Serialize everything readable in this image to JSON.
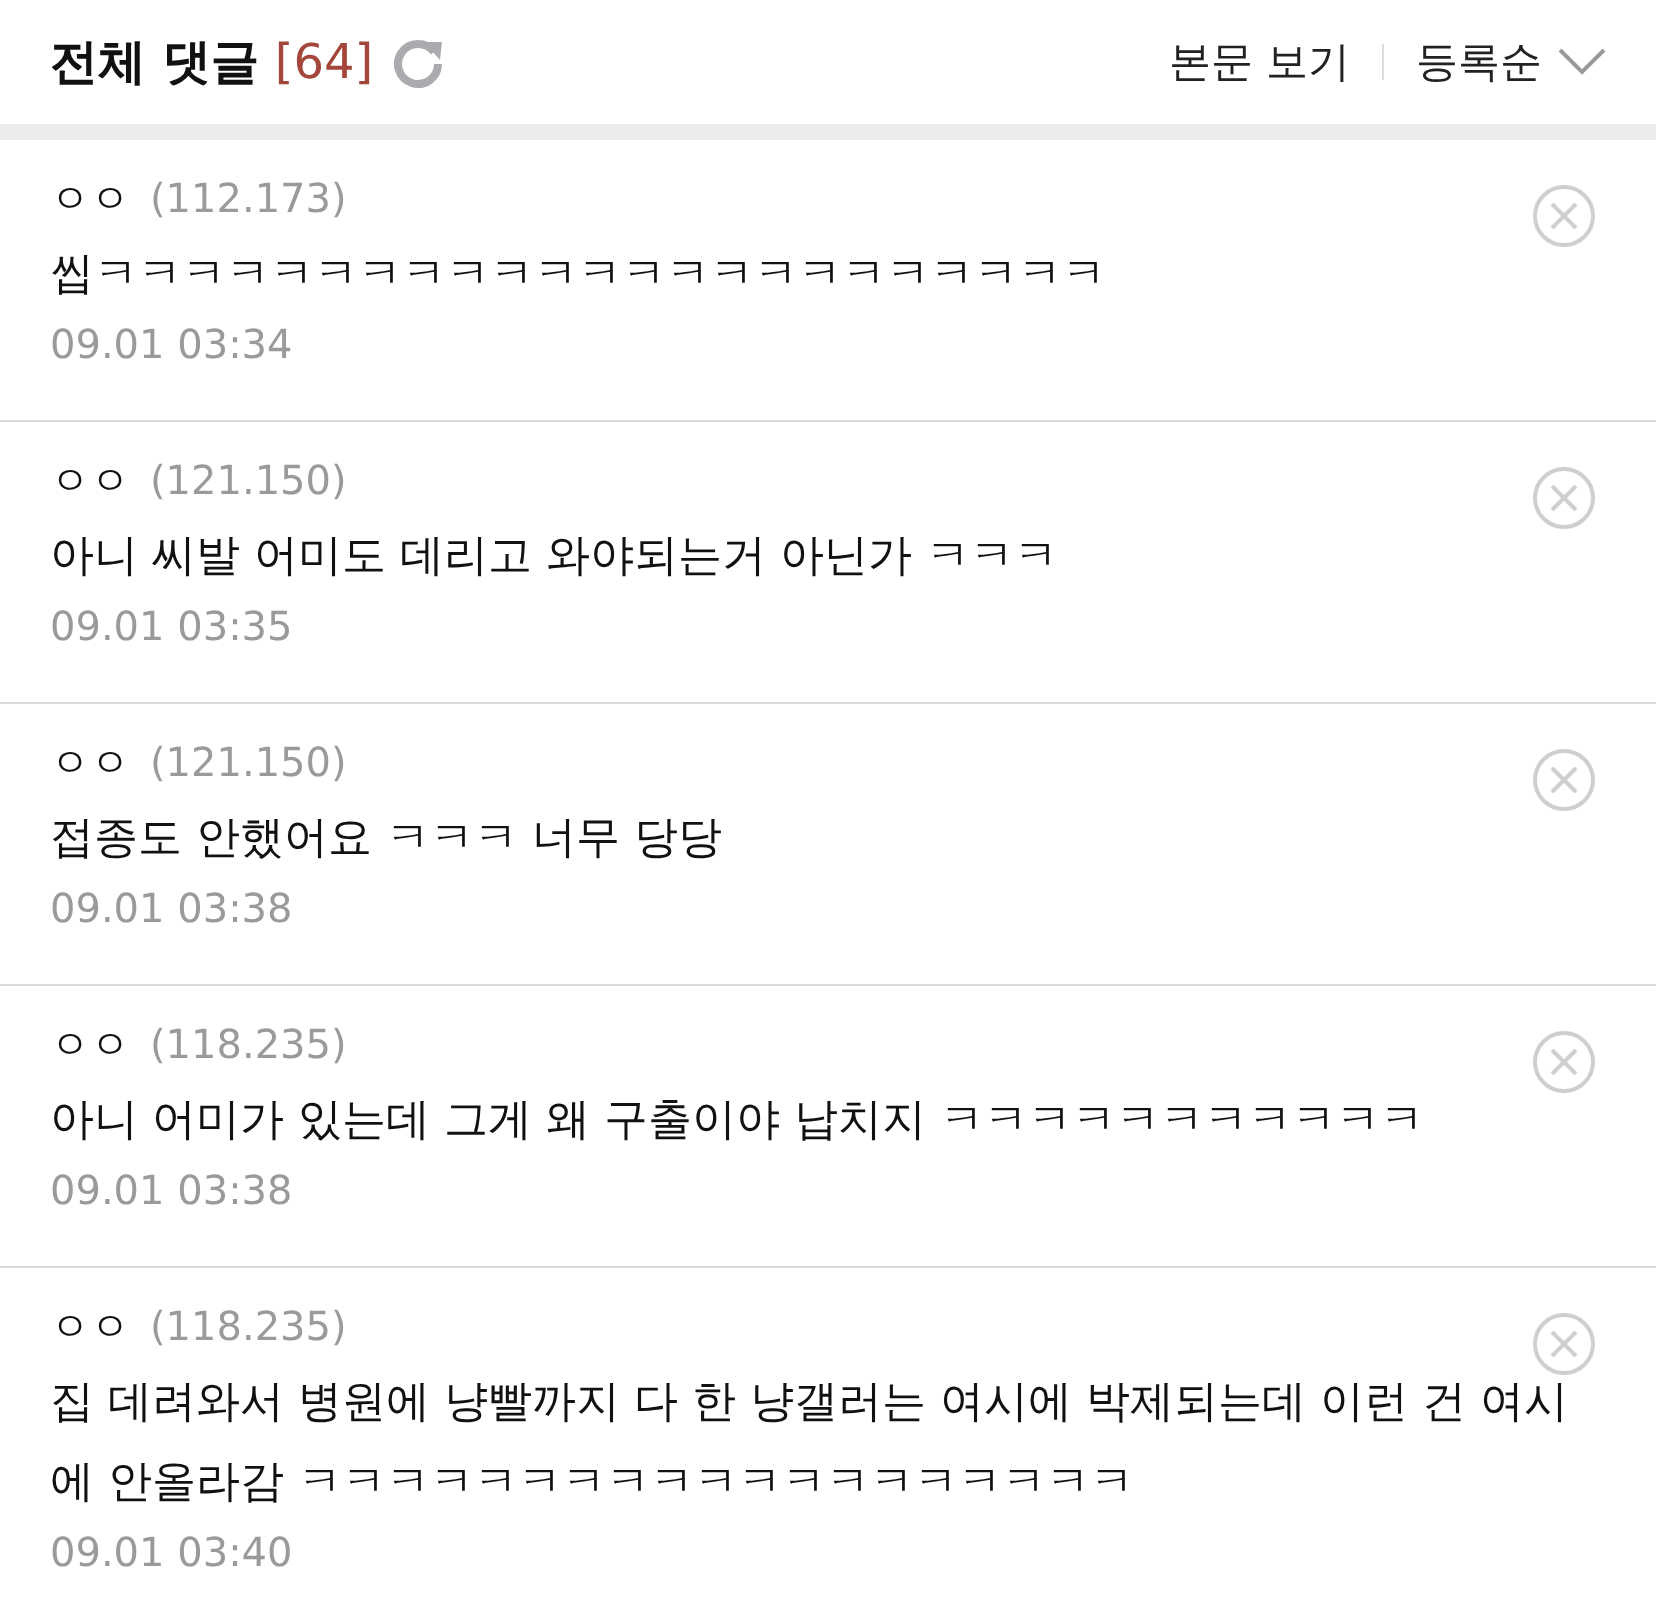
{
  "header": {
    "title": "전체 댓글",
    "count": "[64]",
    "view_post": "본문 보기",
    "sort": "등록순"
  },
  "comments": [
    {
      "author": "ㅇㅇ",
      "ip": "(112.173)",
      "text": "씹ㅋㅋㅋㅋㅋㅋㅋㅋㅋㅋㅋㅋㅋㅋㅋㅋㅋㅋㅋㅋㅋㅋㅋ",
      "date": "09.01 03:34"
    },
    {
      "author": "ㅇㅇ",
      "ip": "(121.150)",
      "text": "아니 씨발 어미도 데리고 와야되는거 아닌가 ㅋㅋㅋ",
      "date": "09.01 03:35"
    },
    {
      "author": "ㅇㅇ",
      "ip": "(121.150)",
      "text": "접종도 안했어요 ㅋㅋㅋ 너무 당당",
      "date": "09.01 03:38"
    },
    {
      "author": "ㅇㅇ",
      "ip": "(118.235)",
      "text": "아니 어미가 있는데 그게 왜 구출이야 납치지 ㅋㅋㅋㅋㅋㅋㅋㅋㅋㅋㅋ",
      "date": "09.01 03:38"
    },
    {
      "author": "ㅇㅇ",
      "ip": "(118.235)",
      "text": "집 데려와서 병원에 냥빨까지 다 한 냥갤러는 여시에 박제되는데 이런 건 여시에 안올라감 ㅋㅋㅋㅋㅋㅋㅋㅋㅋㅋㅋㅋㅋㅋㅋㅋㅋㅋㅋ",
      "date": "09.01 03:40"
    }
  ]
}
